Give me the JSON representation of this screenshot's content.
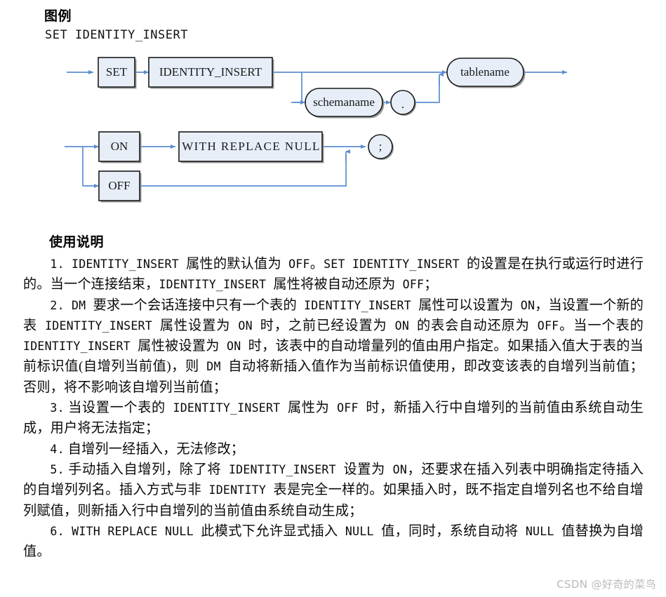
{
  "document": {
    "legend_heading": "图例",
    "syntax_title": "SET IDENTITY_INSERT",
    "usage_heading": "使用说明",
    "watermark": "CSDN @好奇的菜鸟"
  },
  "diagram": {
    "type": "railroad-syntax-diagram",
    "colors": {
      "node_fill": "#e7eef8",
      "node_border": "#1a1a1a",
      "node_shadow": "#9a9a9a",
      "connector": "#5b8dd0"
    },
    "nodes": {
      "set": "SET",
      "identity_insert": "IDENTITY_INSERT",
      "schemaname": "schemaname",
      "dot": ".",
      "tablename": "tablename",
      "on": "ON",
      "off": "OFF",
      "with_replace_null": "WITH  REPLACE  NULL",
      "semicolon": ";"
    }
  },
  "usage": {
    "items": [
      {
        "number": "1.",
        "runs": [
          {
            "t": " IDENTITY_INSERT ",
            "mono": true
          },
          {
            "t": "属性的默认值为",
            "mono": false
          },
          {
            "t": " OFF",
            "mono": true
          },
          {
            "t": "。",
            "mono": false
          },
          {
            "t": "SET IDENTITY_INSERT ",
            "mono": true
          },
          {
            "t": "的设置是在执行或运行时进行的。当一个连接结束，",
            "mono": false
          },
          {
            "t": "IDENTITY_INSERT ",
            "mono": true
          },
          {
            "t": "属性将被自动还原为",
            "mono": false
          },
          {
            "t": " OFF",
            "mono": true
          },
          {
            "t": "；",
            "mono": false
          }
        ]
      },
      {
        "number": "2.",
        "runs": [
          {
            "t": " DM ",
            "mono": true
          },
          {
            "t": "要求一个会话连接中只有一个表的",
            "mono": false
          },
          {
            "t": " IDENTITY_INSERT ",
            "mono": true
          },
          {
            "t": "属性可以设置为",
            "mono": false
          },
          {
            "t": " ON",
            "mono": true
          },
          {
            "t": "，当设置一个新的表",
            "mono": false
          },
          {
            "t": " IDENTITY_INSERT ",
            "mono": true
          },
          {
            "t": "属性设置为",
            "mono": false
          },
          {
            "t": " ON ",
            "mono": true
          },
          {
            "t": "时，之前已经设置为",
            "mono": false
          },
          {
            "t": " ON ",
            "mono": true
          },
          {
            "t": "的表会自动还原为",
            "mono": false
          },
          {
            "t": " OFF",
            "mono": true
          },
          {
            "t": "。当一个表的",
            "mono": false
          },
          {
            "t": " IDENTITY_INSERT ",
            "mono": true
          },
          {
            "t": "属性被设置为",
            "mono": false
          },
          {
            "t": " ON ",
            "mono": true
          },
          {
            "t": "时，该表中的自动增量列的值由用户指定。如果插入值大于表的当前标识值(自增列当前值)，则",
            "mono": false
          },
          {
            "t": " DM ",
            "mono": true
          },
          {
            "t": "自动将新插入值作为当前标识值使用，即改变该表的自增列当前值；否则，将不影响该自增列当前值；",
            "mono": false
          }
        ]
      },
      {
        "number": "3.",
        "runs": [
          {
            "t": " 当设置一个表的",
            "mono": false
          },
          {
            "t": " IDENTITY_INSERT ",
            "mono": true
          },
          {
            "t": "属性为",
            "mono": false
          },
          {
            "t": " OFF ",
            "mono": true
          },
          {
            "t": "时，新插入行中自增列的当前值由系统自动生成，用户将无法指定；",
            "mono": false
          }
        ]
      },
      {
        "number": "4.",
        "runs": [
          {
            "t": " 自增列一经插入，无法修改；",
            "mono": false
          }
        ]
      },
      {
        "number": "5.",
        "runs": [
          {
            "t": " 手动插入自增列，除了将",
            "mono": false
          },
          {
            "t": " IDENTITY_INSERT ",
            "mono": true
          },
          {
            "t": "设置为",
            "mono": false
          },
          {
            "t": " ON",
            "mono": true
          },
          {
            "t": "，还要求在插入列表中明确指定待插入的自增列列名。插入方式与非",
            "mono": false
          },
          {
            "t": " IDENTITY ",
            "mono": true
          },
          {
            "t": "表是完全一样的。如果插入时，既不指定自增列名也不给自增列赋值，则新插入行中自增列的当前值由系统自动生成；",
            "mono": false
          }
        ]
      },
      {
        "number": "6.",
        "runs": [
          {
            "t": " WITH REPLACE NULL ",
            "mono": true
          },
          {
            "t": "此模式下允许显式插入",
            "mono": false
          },
          {
            "t": " NULL ",
            "mono": true
          },
          {
            "t": "值，同时，系统自动将",
            "mono": false
          },
          {
            "t": " NULL ",
            "mono": true
          },
          {
            "t": "值替换为自增值。",
            "mono": false
          }
        ]
      }
    ]
  }
}
